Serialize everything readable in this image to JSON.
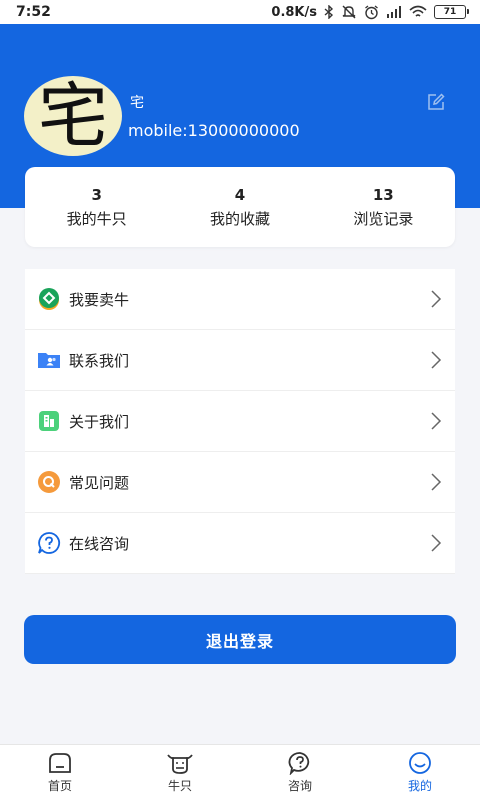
{
  "status_bar": {
    "time": "7:52",
    "network_speed": "0.8K/s",
    "battery": "71",
    "icons": [
      "bluetooth-icon",
      "mute-icon",
      "alarm-icon",
      "signal-icon",
      "wifi-icon",
      "battery-icon"
    ]
  },
  "profile": {
    "avatar_text": "宅",
    "name": "宅",
    "mobile": "mobile:13000000000"
  },
  "stats": [
    {
      "count": "3",
      "label": "我的牛只"
    },
    {
      "count": "4",
      "label": "我的收藏"
    },
    {
      "count": "13",
      "label": "浏览记录"
    }
  ],
  "menu": [
    {
      "label": "我要卖牛",
      "icon": "sell-icon"
    },
    {
      "label": "联系我们",
      "icon": "contact-folder-icon"
    },
    {
      "label": "关于我们",
      "icon": "about-icon"
    },
    {
      "label": "常见问题",
      "icon": "faq-icon"
    },
    {
      "label": "在线咨询",
      "icon": "question-icon"
    }
  ],
  "logout_label": "退出登录",
  "tabs": [
    {
      "label": "首页",
      "icon": "home-icon",
      "active": false
    },
    {
      "label": "牛只",
      "icon": "cow-icon",
      "active": false
    },
    {
      "label": "咨询",
      "icon": "consult-icon",
      "active": false
    },
    {
      "label": "我的",
      "icon": "profile-icon",
      "active": true
    }
  ],
  "colors": {
    "primary": "#1466e0",
    "background": "#f4f5f9",
    "sell_icon_green": "#1aa35a",
    "sell_icon_orange": "#f5a623",
    "contact_icon_blue": "#3b82f6",
    "about_icon_green": "#4cd17b",
    "faq_icon_orange": "#f59a3c",
    "question_icon_blue": "#1466e0"
  }
}
